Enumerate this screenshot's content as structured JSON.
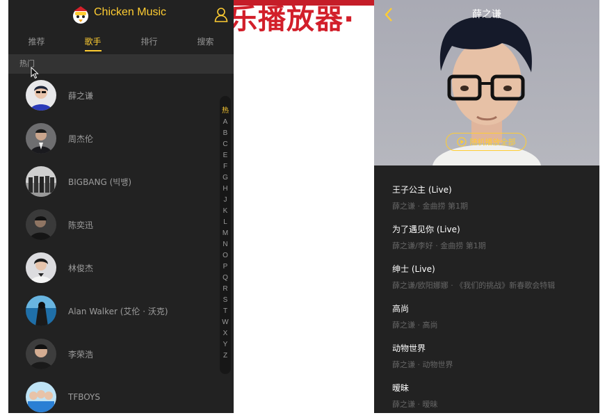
{
  "background": {
    "title_partial": "乐播放器·"
  },
  "left": {
    "header": {
      "title": "Chicken Music",
      "logo": "chicken-logo",
      "user": "user-icon"
    },
    "tabs": [
      {
        "label": "推荐",
        "active": false
      },
      {
        "label": "歌手",
        "active": true
      },
      {
        "label": "排行",
        "active": false
      },
      {
        "label": "搜索",
        "active": false
      }
    ],
    "group_title": "热门",
    "singers": [
      {
        "name": "薛之谦"
      },
      {
        "name": "周杰伦"
      },
      {
        "name": "BIGBANG (빅뱅)"
      },
      {
        "name": "陈奕迅"
      },
      {
        "name": "林俊杰"
      },
      {
        "name": "Alan Walker (艾伦 · 沃克)"
      },
      {
        "name": "李荣浩"
      },
      {
        "name": "TFBOYS"
      }
    ],
    "shortcut": [
      "热",
      "A",
      "B",
      "C",
      "E",
      "F",
      "G",
      "H",
      "J",
      "K",
      "L",
      "M",
      "N",
      "O",
      "P",
      "Q",
      "R",
      "S",
      "T",
      "W",
      "X",
      "Y",
      "Z"
    ]
  },
  "right": {
    "title": "薛之谦",
    "back": "chevron-left-icon",
    "play_all": "随机播放全部",
    "songs": [
      {
        "name": "王子公主 (Live)",
        "desc": "薛之谦 · 金曲捞 第1期"
      },
      {
        "name": "为了遇见你 (Live)",
        "desc": "薛之谦/李好 · 金曲捞 第1期"
      },
      {
        "name": "绅士 (Live)",
        "desc": "薛之谦/欧阳娜娜 · 《我们的挑战》新春歌会特辑"
      },
      {
        "name": "高尚",
        "desc": "薛之谦 · 高尚"
      },
      {
        "name": "动物世界",
        "desc": "薛之谦 · 动物世界"
      },
      {
        "name": "暧昧",
        "desc": "薛之谦 · 暧昧"
      }
    ]
  },
  "colors": {
    "accent": "#ffcd32",
    "bg": "#222222",
    "highlight": "#333333",
    "red": "#d21f2a"
  }
}
